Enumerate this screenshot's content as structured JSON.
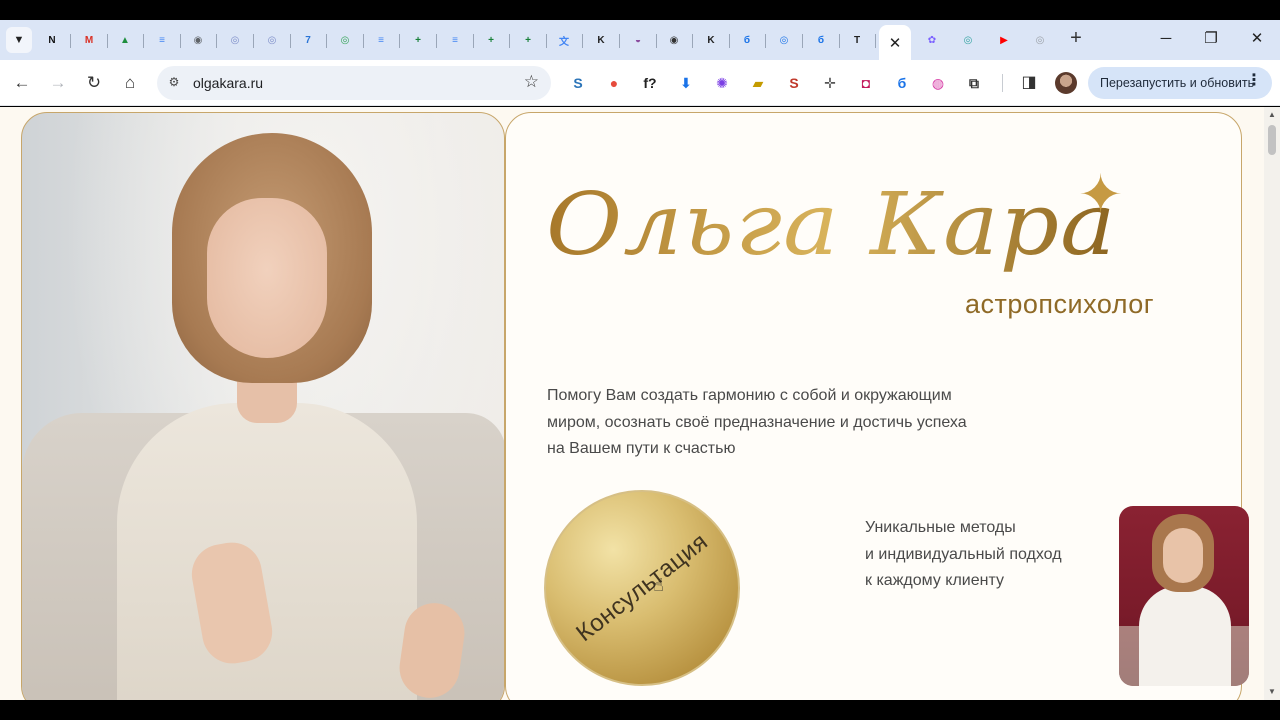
{
  "browser": {
    "tabs": [
      {
        "icon": "notion-icon",
        "glyph": "N",
        "color": "#111111"
      },
      {
        "icon": "gmail-icon",
        "glyph": "M",
        "color": "#d93025"
      },
      {
        "icon": "google-drive-icon",
        "glyph": "▲",
        "color": "#1e8e3e"
      },
      {
        "icon": "google-docs-icon",
        "glyph": "≡",
        "color": "#4285f4"
      },
      {
        "icon": "web-tab-icon",
        "glyph": "◉",
        "color": "#5f6368"
      },
      {
        "icon": "web-tab-icon",
        "glyph": "◎",
        "color": "#7c8cc8"
      },
      {
        "icon": "web-tab-icon",
        "glyph": "◎",
        "color": "#7c8cc8"
      },
      {
        "icon": "seven-icon",
        "glyph": "7",
        "color": "#2a74d6"
      },
      {
        "icon": "web-tab-icon",
        "glyph": "◎",
        "color": "#31a354"
      },
      {
        "icon": "google-docs-icon",
        "glyph": "≡",
        "color": "#4285f4"
      },
      {
        "icon": "google-sheets-icon",
        "glyph": "+",
        "color": "#188038"
      },
      {
        "icon": "google-docs-icon",
        "glyph": "≡",
        "color": "#4285f4"
      },
      {
        "icon": "google-sheets-icon",
        "glyph": "+",
        "color": "#188038"
      },
      {
        "icon": "google-sheets-icon",
        "glyph": "+",
        "color": "#188038"
      },
      {
        "icon": "translate-icon",
        "glyph": "文",
        "color": "#4285f4"
      },
      {
        "icon": "k-logo-icon",
        "glyph": "K",
        "color": "#222222"
      },
      {
        "icon": "web-tab-icon",
        "glyph": "◒",
        "color": "#8b4d9e"
      },
      {
        "icon": "web-tab-icon",
        "glyph": "◉",
        "color": "#333333"
      },
      {
        "icon": "k-logo-icon",
        "glyph": "K",
        "color": "#222222"
      },
      {
        "icon": "b-logo-icon",
        "glyph": "б",
        "color": "#1a73e8"
      },
      {
        "icon": "web-tab-icon",
        "glyph": "◎",
        "color": "#1a73e8"
      },
      {
        "icon": "b-logo-icon",
        "glyph": "б",
        "color": "#1a73e8"
      },
      {
        "icon": "t-logo-icon",
        "glyph": "T",
        "color": "#222222"
      }
    ],
    "active_tab_close": "✕",
    "tabs_after": [
      {
        "icon": "colorful-app-icon",
        "glyph": "✿",
        "color": "#7b61ff"
      },
      {
        "icon": "web-tab-icon",
        "glyph": "◎",
        "color": "#31a3a0"
      },
      {
        "icon": "youtube-icon",
        "glyph": "▶",
        "color": "#ff0000"
      },
      {
        "icon": "web-tab-icon",
        "glyph": "◎",
        "color": "#9aa0a6"
      }
    ],
    "new_tab": "+",
    "window": {
      "minimize": "─",
      "restore": "❐",
      "close": "✕"
    },
    "nav": {
      "back": "←",
      "forward": "→",
      "reload": "↻",
      "home": "⌂"
    },
    "url": "olgakara.ru",
    "bookmark_star": "☆",
    "extensions": [
      {
        "icon": "s-extension-icon",
        "glyph": "S",
        "color": "#2b74b8"
      },
      {
        "icon": "color-wheel-icon",
        "glyph": "●",
        "color": "#e64b3c"
      },
      {
        "icon": "font-finder-icon",
        "glyph": "f?",
        "color": "#222222"
      },
      {
        "icon": "download-icon",
        "glyph": "⬇",
        "color": "#1a73e8"
      },
      {
        "icon": "purple-flower-icon",
        "glyph": "✺",
        "color": "#7b3fe4"
      },
      {
        "icon": "yellow-ext-icon",
        "glyph": "▰",
        "color": "#c49b00"
      },
      {
        "icon": "s-red-icon",
        "glyph": "S",
        "color": "#c0392b"
      },
      {
        "icon": "move-icon",
        "glyph": "✛",
        "color": "#555555"
      },
      {
        "icon": "pink-picker-icon",
        "glyph": "◘",
        "color": "#c2185b"
      },
      {
        "icon": "b-logo-icon",
        "glyph": "б",
        "color": "#1a73e8"
      },
      {
        "icon": "gradient-ext-icon",
        "glyph": "◍",
        "color": "#d63aa5"
      },
      {
        "icon": "puzzle-icon",
        "glyph": "⧉",
        "color": "#333333"
      }
    ],
    "sidepanel": "◨",
    "relaunch_label": "Перезапустить и обновить",
    "menu_dots": "⋮"
  },
  "hero": {
    "name": "Ольга Кара",
    "star": "✦",
    "subtitle": "астропсихолог",
    "tagline": [
      "Помогу Вам создать гармонию с собой и окружающим",
      "миром, осознать своё предназначение и достичь успеха",
      "на Вашем пути к счастью"
    ],
    "consult_button": "Консультация",
    "unique": [
      "Уникальные методы",
      "и индивидуальный подход",
      "к каждому клиенту"
    ]
  }
}
